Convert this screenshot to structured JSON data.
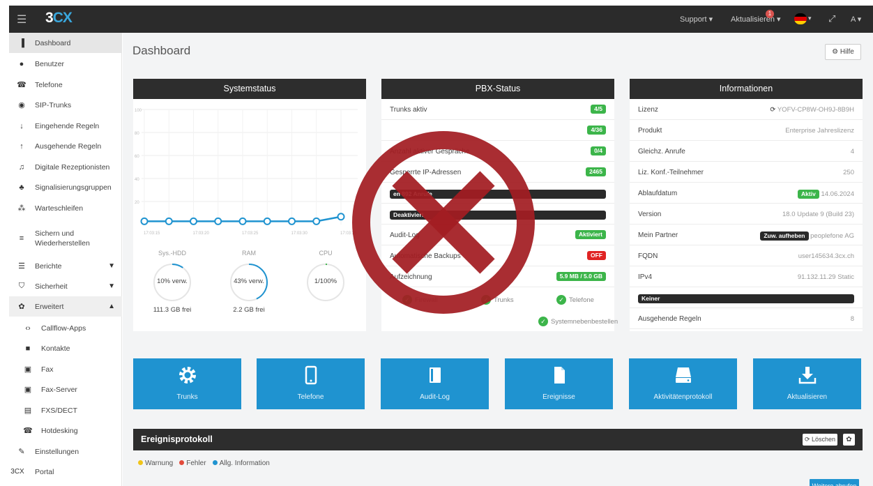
{
  "topbar": {
    "logo_a": "3",
    "logo_b": "CX",
    "support": "Support ▾",
    "update": "Aktualisieren ▾",
    "update_badge": "1",
    "user": "A ▾"
  },
  "sidebar": {
    "items": [
      {
        "label": "Dashboard",
        "icon": "bar-chart-icon"
      },
      {
        "label": "Benutzer",
        "icon": "user-icon"
      },
      {
        "label": "Telefone",
        "icon": "phone-icon"
      },
      {
        "label": "SIP-Trunks",
        "icon": "globe-icon"
      },
      {
        "label": "Eingehende Regeln",
        "icon": "arrow-down-icon"
      },
      {
        "label": "Ausgehende Regeln",
        "icon": "arrow-up-icon"
      },
      {
        "label": "Digitale Rezeptionisten",
        "icon": "headset-icon"
      },
      {
        "label": "Signalisierungsgruppen",
        "icon": "group-icon"
      },
      {
        "label": "Warteschleifen",
        "icon": "queue-icon"
      },
      {
        "label": "Sichern und",
        "label2": "Wiederherstellen",
        "icon": "database-icon"
      },
      {
        "label": "Berichte",
        "icon": "list-icon"
      },
      {
        "label": "Sicherheit",
        "icon": "shield-icon"
      },
      {
        "label": "Erweitert",
        "icon": "gear-icon"
      },
      {
        "label": "Callflow-Apps",
        "icon": "code-icon"
      },
      {
        "label": "Kontakte",
        "icon": "contacts-icon"
      },
      {
        "label": "Fax",
        "icon": "fax-icon"
      },
      {
        "label": "Fax-Server",
        "icon": "fax-server-icon"
      },
      {
        "label": "FXS/DECT",
        "icon": "device-icon"
      },
      {
        "label": "Hotdesking",
        "icon": "phone-icon"
      },
      {
        "label": "Einstellungen",
        "icon": "wrench-icon"
      },
      {
        "label": "Portal",
        "icon": "3cx-logo"
      }
    ],
    "portal_logo": "3CX"
  },
  "main": {
    "title": "Dashboard",
    "help": "Hilfe"
  },
  "system_status": {
    "title": "Systemstatus",
    "gauges": [
      {
        "label": "Sys.-HDD",
        "value": "10% verw.",
        "free": "111.3 GB frei",
        "pct": 10
      },
      {
        "label": "RAM",
        "value": "43% verw.",
        "free": "2.2 GB frei",
        "pct": 43
      },
      {
        "label": "CPU",
        "value": "1/100%",
        "free": "",
        "pct": 1
      }
    ]
  },
  "chart_data": {
    "type": "line",
    "x": [
      "17:03:15",
      "17:03:20",
      "17:03:25",
      "17:03:30",
      "17:03:35"
    ],
    "series": [
      {
        "values": [
          1,
          1,
          1,
          1,
          1,
          1,
          1,
          1,
          5
        ]
      }
    ],
    "ylim": [
      0,
      100
    ],
    "yticks": [
      "100",
      "80",
      "60",
      "40",
      "20"
    ],
    "grid": true
  },
  "pbx_status": {
    "title": "PBX-Status",
    "rows": [
      {
        "key": "Trunks aktiv",
        "value": "4/5",
        "style": "g"
      },
      {
        "key": "",
        "value": "4/36",
        "style": "g"
      },
      {
        "key": "Anzahl aktiver Gespräche",
        "value": "0/4",
        "style": "g"
      },
      {
        "key": "Gesperrte IP-Adressen",
        "value": "2465",
        "style": "g"
      },
      {
        "key": "Rufliste",
        "value": "en 892 Anrufe",
        "style": "k"
      },
      {
        "key": "Chat-Protokoll",
        "value": "Deaktiviert",
        "style": "k"
      },
      {
        "key": "Audit-Log",
        "value": "Aktiviert",
        "style": "g"
      },
      {
        "key": "Automatische Backups",
        "value": "OFF",
        "style": "r"
      },
      {
        "key": "Aufzeichnung",
        "value": "5.9 MB / 5.0 GB",
        "style": "g"
      }
    ],
    "checks": [
      "Firewall",
      "Trunks",
      "Telefone",
      "Systemnebenbestellen"
    ]
  },
  "info": {
    "title": "Informationen",
    "rows": [
      {
        "key": "Lizenz",
        "value": "YOFV-CP8W-OH9J-8B9H"
      },
      {
        "key": "Produkt",
        "value": "Enterprise Jahreslizenz"
      },
      {
        "key": "Gleichz. Anrufe",
        "value": "4"
      },
      {
        "key": "Liz. Konf.-Teilnehmer",
        "value": "250"
      },
      {
        "key": "Ablaufdatum",
        "value": "14.06.2024",
        "pill": "Aktiv"
      },
      {
        "key": "Version",
        "value": "18.0 Update 9 (Build 23)"
      },
      {
        "key": "Mein Partner",
        "value": "peoplefone AG",
        "pill": "Zuw. aufheben"
      },
      {
        "key": "FQDN",
        "value": "user145634.3cx.ch"
      },
      {
        "key": "IPv4",
        "value": "91.132.11.29 Static"
      },
      {
        "key": "IPv6",
        "value": "",
        "pill": "Keiner"
      },
      {
        "key": "Ausgehende Regeln",
        "value": "8"
      }
    ]
  },
  "tiles": [
    {
      "label": "Trunks",
      "icon": "gear-icon"
    },
    {
      "label": "Telefone",
      "icon": "mobile-icon"
    },
    {
      "label": "Audit-Log",
      "icon": "book-icon"
    },
    {
      "label": "Ereignisse",
      "icon": "file-icon"
    },
    {
      "label": "Aktivitätenprotokoll",
      "icon": "drive-icon"
    },
    {
      "label": "Aktualisieren",
      "icon": "download-icon"
    }
  ],
  "events": {
    "title": "Ereignisprotokoll",
    "clear": "Löschen",
    "legend": [
      {
        "label": "Warnung",
        "color": "#f0c419"
      },
      {
        "label": "Fehler",
        "color": "#e24b3b"
      },
      {
        "label": "Allg. Information",
        "color": "#1f93d0"
      }
    ],
    "more": "Weitere abrufen"
  },
  "overlay": {
    "icon": "x-circle-icon",
    "color": "#a31d22"
  }
}
